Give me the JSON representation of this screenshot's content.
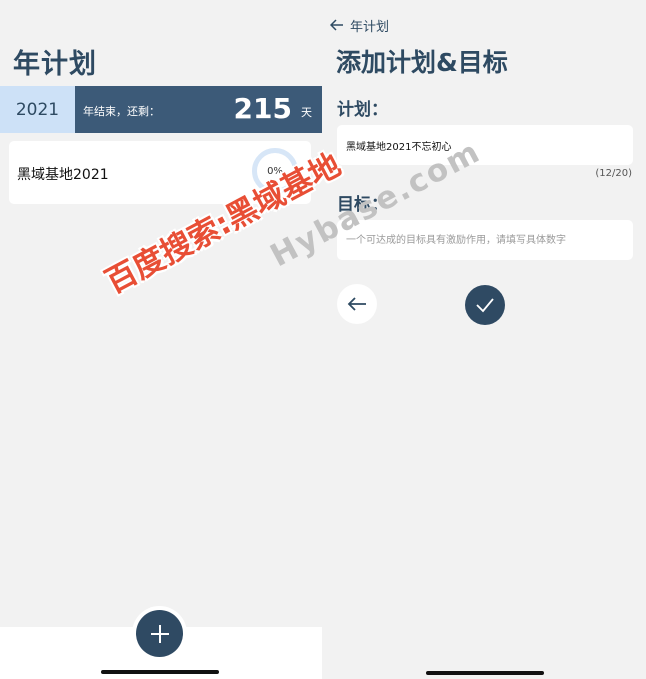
{
  "left": {
    "title": "年计划",
    "year": "2021",
    "remain_label": "年结束，还剩：",
    "remain_days": "215",
    "remain_unit": "天",
    "plans": [
      {
        "name": "黑域基地2021",
        "progress": "0%"
      }
    ],
    "add_icon": "plus-icon"
  },
  "right": {
    "back_label": "年计划",
    "back_icon": "arrow-left-icon",
    "title": "添加计划&目标",
    "plan_label": "计划：",
    "plan_value": "黑域基地2021不忘初心",
    "plan_counter": "(12/20)",
    "goal_label": "目标：",
    "goal_placeholder": "一个可达成的目标具有激励作用，请填写具体数字",
    "cancel_icon": "arrow-left-icon",
    "confirm_icon": "checkmark-icon"
  },
  "watermark": {
    "cn": "百度搜索:黑域基地",
    "en": "Hybase.com"
  },
  "colors": {
    "primary_dark": "#2f4a63",
    "remain_bar": "#3c5a78",
    "year_box": "#cde1f7",
    "progress_ring": "#d7e6f7",
    "background": "#f2f2f2",
    "watermark_red": "#e84e35"
  }
}
